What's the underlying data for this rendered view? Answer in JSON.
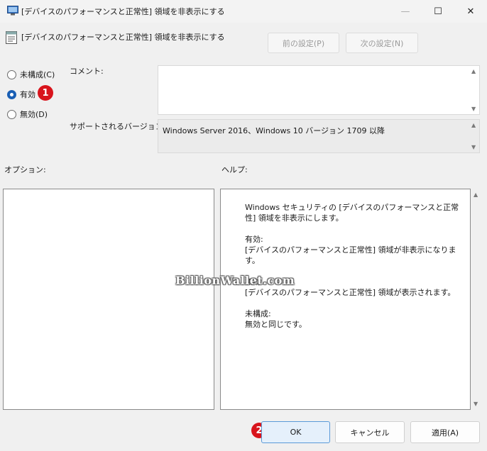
{
  "window": {
    "title": "[デバイスのパフォーマンスと正常性] 領域を非表示にする",
    "minimize_glyph": "—",
    "maximize_glyph": "☐",
    "close_glyph": "✕"
  },
  "header": {
    "policy_title": "[デバイスのパフォーマンスと正常性] 領域を非表示にする",
    "prev_label": "前の設定(P)",
    "next_label": "次の設定(N)"
  },
  "state": {
    "options": [
      {
        "label": "未構成(C)",
        "selected": false
      },
      {
        "label": "有効",
        "selected": true
      },
      {
        "label": "無効(D)",
        "selected": false
      }
    ]
  },
  "comment": {
    "label": "コメント:",
    "value": ""
  },
  "supported": {
    "label": "サポートされるバージョン:",
    "value": "Windows Server 2016、Windows 10 バージョン 1709 以降"
  },
  "sections": {
    "options_label": "オプション:",
    "help_label": "ヘルプ:"
  },
  "help": {
    "intro": "Windows セキュリティの [デバイスのパフォーマンスと正常性] 領域を非表示にします。",
    "enabled_title": "有効:",
    "enabled_text": "[デバイスのパフォーマンスと正常性] 領域が非表示になります。",
    "disabled_title": "無効:",
    "disabled_text": "[デバイスのパフォーマンスと正常性] 領域が表示されます。",
    "unconf_title": "未構成:",
    "unconf_text": "無効と同じです。"
  },
  "footer": {
    "ok_label": "OK",
    "cancel_label": "キャンセル",
    "apply_label": "適用(A)"
  },
  "badges": {
    "step1": "1",
    "step2": "2"
  },
  "watermark": "BillionWallet.com",
  "colors": {
    "accent": "#1a5fb4",
    "badge": "#d8141c"
  }
}
